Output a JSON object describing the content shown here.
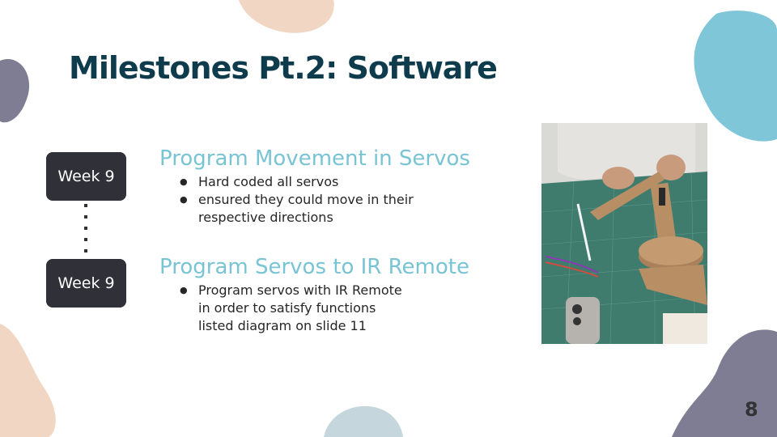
{
  "slide": {
    "title": "Milestones Pt.2: Software",
    "page_number": "8"
  },
  "milestones": [
    {
      "week": "Week 9",
      "heading": "Program Movement in Servos",
      "bullets": [
        [
          "Hard coded all servos"
        ],
        [
          "ensured they could move in their",
          "respective directions"
        ]
      ]
    },
    {
      "week": "Week 9",
      "heading": "Program Servos to IR Remote",
      "bullets": [
        [
          "Program servos with IR Remote",
          "in order to satisfy functions",
          "listed diagram on slide 11"
        ]
      ]
    }
  ],
  "colors": {
    "title": "#0f3c4c",
    "heading": "#78c4d4",
    "pill": "#2f3038",
    "blob_peach": "#f2d6c4",
    "blob_blue": "#7ec6d8",
    "blob_purple": "#7f7d93",
    "blob_gray_blue": "#c5d6dc"
  },
  "photo": {
    "icon": "robot-arm-build-photo"
  }
}
